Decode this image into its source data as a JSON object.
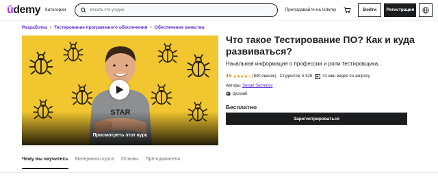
{
  "header": {
    "logo": "ūdemy",
    "logo_first": "ū",
    "logo_rest": "demy",
    "categories": "Категории",
    "search_placeholder": "Искать что угодно",
    "teach": "Преподавайте на Udemy",
    "login": "Войти",
    "signup": "Регистрация"
  },
  "breadcrumb": [
    "Разработка",
    "Тестирование программного обеспечения",
    "Обеспечение качества"
  ],
  "video": {
    "preview_label": "Просмотреть этот курс",
    "shirt_text": "STAR"
  },
  "course": {
    "title": "Что такое Тестирование ПО? Как и куда развиваться?",
    "subtitle": "Начальная информация о профессии и роли тестировщика.",
    "rating": "4,5",
    "stars": "★★★★½",
    "ratings_count": "(840 оценок)",
    "students": "Студентов: 5 528",
    "video_hours": "41 мин видео по запросу",
    "authors_label": "Авторы:",
    "author": "Sergei Semenov",
    "language": "русский",
    "price": "Бесплатно",
    "enroll": "Зарегистрироваться"
  },
  "tabs": [
    {
      "label": "Чему вы научитесь",
      "active": true
    },
    {
      "label": "Материалы курса",
      "active": false
    },
    {
      "label": "Отзывы",
      "active": false
    },
    {
      "label": "Преподаватели",
      "active": false
    }
  ],
  "colors": {
    "accent": "#5624d0",
    "brand": "#a435f0",
    "video_bg": "#f1c62e",
    "star": "#e59819",
    "rating": "#b4690e"
  }
}
